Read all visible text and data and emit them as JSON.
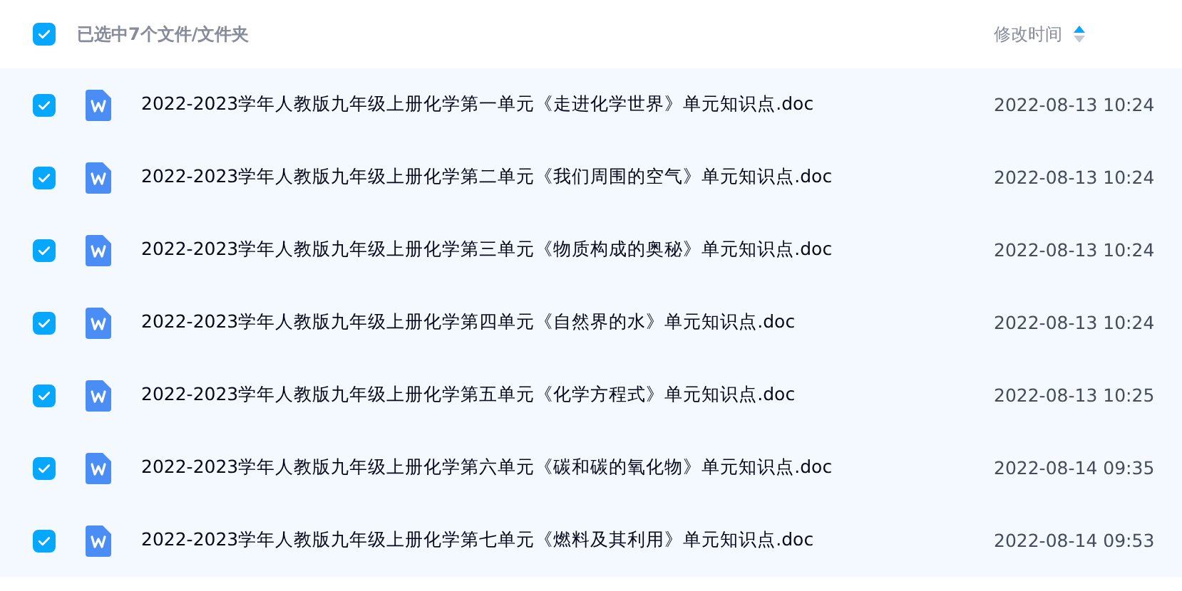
{
  "header": {
    "checked": true,
    "selection_label": "已选中7个文件/文件夹",
    "time_column": "修改时间",
    "sort_ascending": true
  },
  "files": [
    {
      "name": "2022-2023学年人教版九年级上册化学第一单元《走进化学世界》单元知识点.doc",
      "modified": "2022-08-13 10:24",
      "checked": true
    },
    {
      "name": "2022-2023学年人教版九年级上册化学第二单元《我们周围的空气》单元知识点.doc",
      "modified": "2022-08-13 10:24",
      "checked": true
    },
    {
      "name": "2022-2023学年人教版九年级上册化学第三单元《物质构成的奥秘》单元知识点.doc",
      "modified": "2022-08-13 10:24",
      "checked": true
    },
    {
      "name": "2022-2023学年人教版九年级上册化学第四单元《自然界的水》单元知识点.doc",
      "modified": "2022-08-13 10:24",
      "checked": true
    },
    {
      "name": "2022-2023学年人教版九年级上册化学第五单元《化学方程式》单元知识点.doc",
      "modified": "2022-08-13 10:25",
      "checked": true
    },
    {
      "name": "2022-2023学年人教版九年级上册化学第六单元《碳和碳的氧化物》单元知识点.doc",
      "modified": "2022-08-14 09:35",
      "checked": true
    },
    {
      "name": "2022-2023学年人教版九年级上册化学第七单元《燃料及其利用》单元知识点.doc",
      "modified": "2022-08-14 09:53",
      "checked": true
    }
  ]
}
